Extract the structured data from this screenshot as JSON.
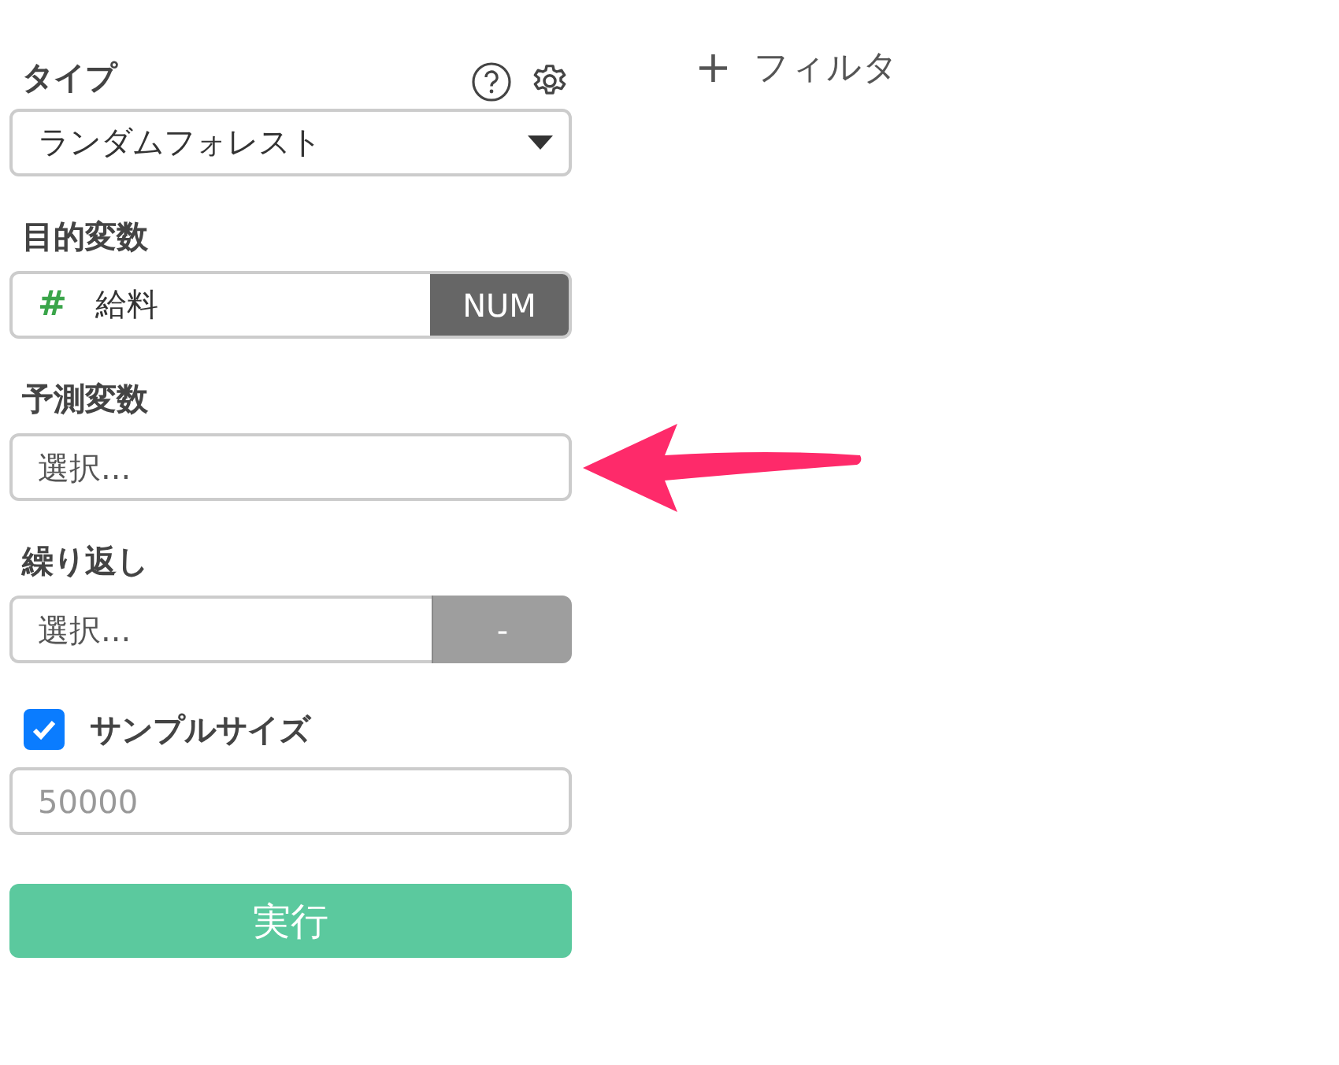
{
  "panel": {
    "sections": [
      {
        "kind": "dropdown",
        "label": "タイプ",
        "value": "ランダムフォレスト"
      },
      {
        "kind": "typed",
        "label": "目的変数",
        "type_symbol": "#",
        "value": "給料",
        "type_badge": "NUM"
      },
      {
        "kind": "select",
        "label": "予測変数",
        "placeholder": "選択...",
        "highlighted": true
      },
      {
        "kind": "select_button",
        "label": "繰り返し",
        "placeholder": "選択...",
        "button": "-"
      },
      {
        "kind": "checkbox_input",
        "label": "サンプルサイズ",
        "checked": true,
        "placeholder": "50000"
      }
    ],
    "run_button": "実行"
  },
  "filter_button": {
    "symbol": "+",
    "label": "フィルタ"
  }
}
